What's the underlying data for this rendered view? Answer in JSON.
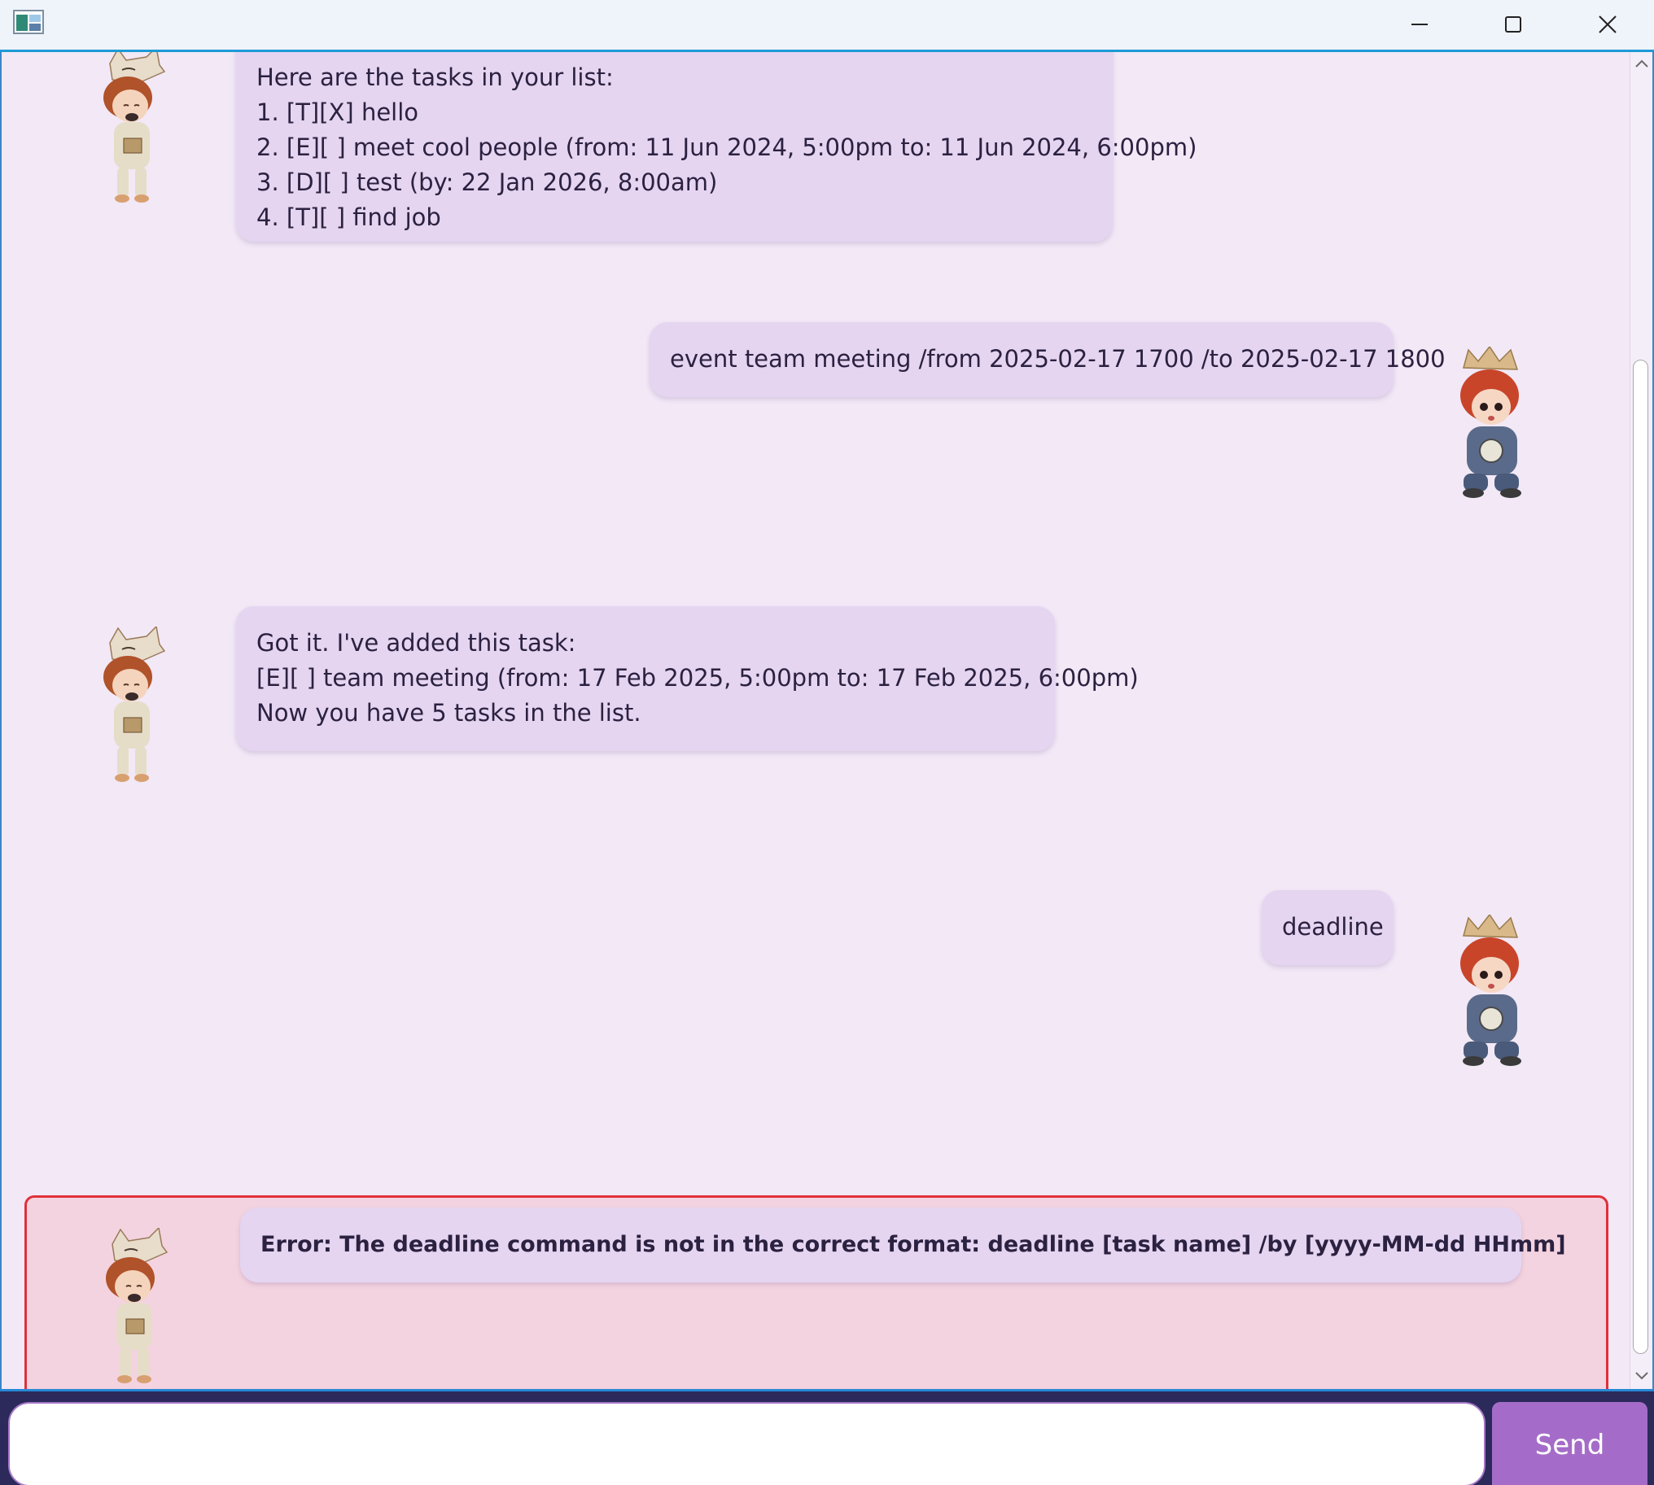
{
  "window": {
    "minimize_icon": "minimize-icon",
    "maximize_icon": "maximize-icon",
    "close_icon": "close-icon"
  },
  "messages": [
    {
      "sender": "bot",
      "lines": [
        "Here are the tasks in your list:",
        "1. [T][X] hello",
        "2. [E][ ] meet cool people (from: 11 Jun 2024, 5:00pm to: 11 Jun 2024, 6:00pm)",
        "3. [D][ ] test (by: 22 Jan 2026, 8:00am)",
        "4. [T][ ] find job"
      ]
    },
    {
      "sender": "user",
      "lines": [
        "event team meeting /from 2025-02-17 1700 /to 2025-02-17 1800"
      ]
    },
    {
      "sender": "bot",
      "lines": [
        "Got it. I've added this task:",
        "[E][ ] team meeting (from: 17 Feb 2025, 5:00pm to: 17 Feb 2025, 6:00pm)",
        "Now you have 5 tasks in the list."
      ]
    },
    {
      "sender": "user",
      "lines": [
        "deadline"
      ]
    },
    {
      "sender": "bot",
      "error": true,
      "lines": [
        "Error: The deadline command is not in the correct format: deadline [task name] /by [yyyy-MM-dd HHmm]"
      ]
    }
  ],
  "input": {
    "value": "",
    "placeholder": ""
  },
  "send_button": {
    "label": "Send"
  },
  "colors": {
    "chat_background": "#f2e8f6",
    "bubble": "#e5d5f1",
    "error_background": "#f4d3e0",
    "error_border": "#e0303a",
    "send_button": "#a46cc8",
    "input_bar": "#2b2a5a"
  }
}
